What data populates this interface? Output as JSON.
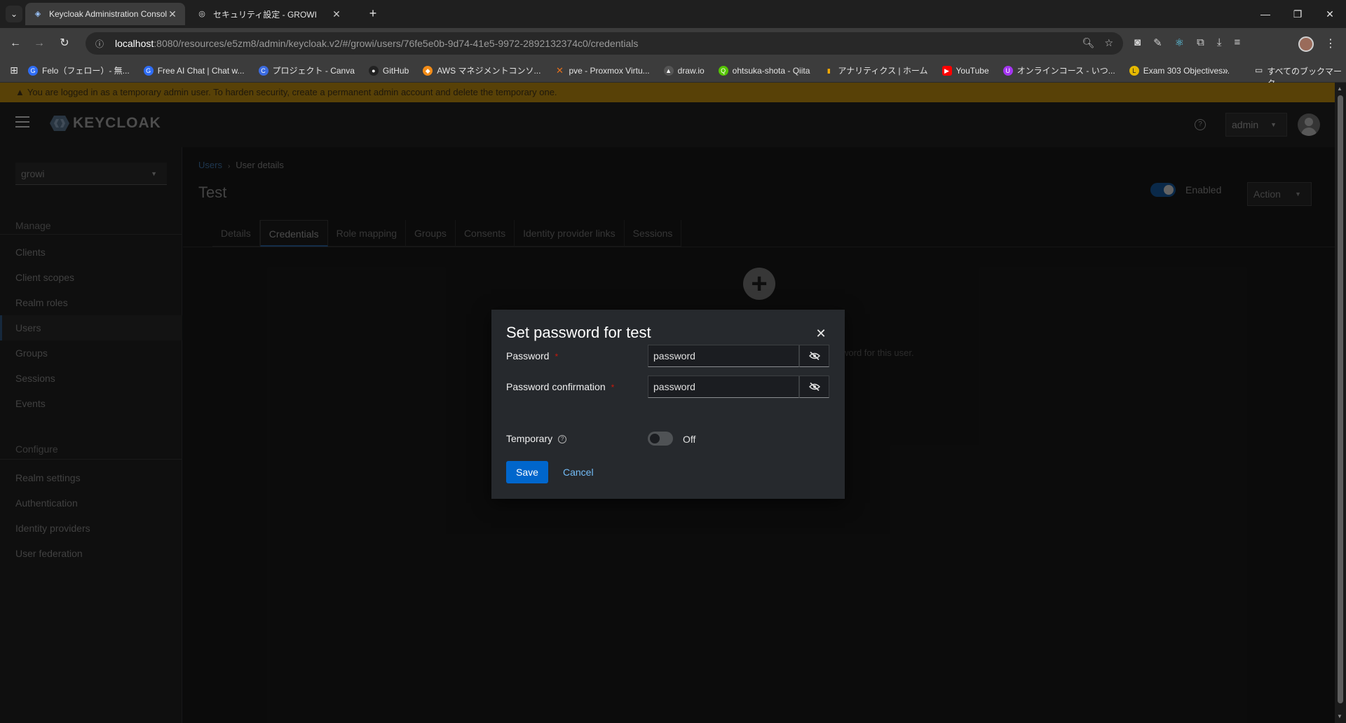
{
  "browser": {
    "tabs": [
      {
        "title": "Keycloak Administration Console",
        "active": true
      },
      {
        "title": "セキュリティ設定 - GROWI",
        "active": false
      }
    ],
    "url_host": "localhost",
    "url_path": ":8080/resources/e5zm8/admin/keycloak.v2/#/growi/users/76fe5e0b-9d74-41e5-9972-2892132374c0/credentials",
    "bookmarks": [
      {
        "label": "Felo（フェロー）- 無...",
        "color": "#2f6df5"
      },
      {
        "label": "Free AI Chat | Chat w...",
        "color": "#2f6df5"
      },
      {
        "label": "プロジェクト - Canva",
        "color": "#3b6be0"
      },
      {
        "label": "GitHub",
        "color": "#222222"
      },
      {
        "label": "AWS マネジメントコンソ...",
        "color": "#f28c18"
      },
      {
        "label": "pve - Proxmox Virtu...",
        "color": "#e5701b"
      },
      {
        "label": "draw.io",
        "color": "#555555"
      },
      {
        "label": "ohtsuka-shota - Qiita",
        "color": "#55c500"
      },
      {
        "label": "アナリティクス | ホーム",
        "color": "#f9ab00"
      },
      {
        "label": "YouTube",
        "color": "#ff0000"
      },
      {
        "label": "オンラインコース - いつ...",
        "color": "#a435f0"
      },
      {
        "label": "Exam 303 Objectives...",
        "color": "#e5b800"
      }
    ],
    "bookmarks_all": "すべてのブックマーク"
  },
  "banner": {
    "text": "You are logged in as a temporary admin user. To harden security, create a permanent admin account and delete the temporary one."
  },
  "header": {
    "logo_text": "KEYCLOAK",
    "user_menu": "admin"
  },
  "sidebar": {
    "realm": "growi",
    "manage_label": "Manage",
    "manage_items": [
      "Clients",
      "Client scopes",
      "Realm roles",
      "Users",
      "Groups",
      "Sessions",
      "Events"
    ],
    "configure_label": "Configure",
    "configure_items": [
      "Realm settings",
      "Authentication",
      "Identity providers",
      "User federation"
    ]
  },
  "main": {
    "breadcrumb_link": "Users",
    "breadcrumb_current": "User details",
    "title": "Test",
    "enabled_label": "Enabled",
    "action_label": "Action",
    "tabs": [
      "Details",
      "Credentials",
      "Role mapping",
      "Groups",
      "Consents",
      "Identity provider links",
      "Sessions"
    ],
    "empty_text": "word for this user."
  },
  "modal": {
    "title": "Set password for test",
    "password_label": "Password",
    "password_value": "password",
    "confirm_label": "Password confirmation",
    "confirm_value": "password",
    "temporary_label": "Temporary",
    "temporary_state": "Off",
    "save_label": "Save",
    "cancel_label": "Cancel"
  },
  "colors": {
    "primary": "#0066cc",
    "banner": "#7a5b0b",
    "link": "#73bcf7"
  }
}
